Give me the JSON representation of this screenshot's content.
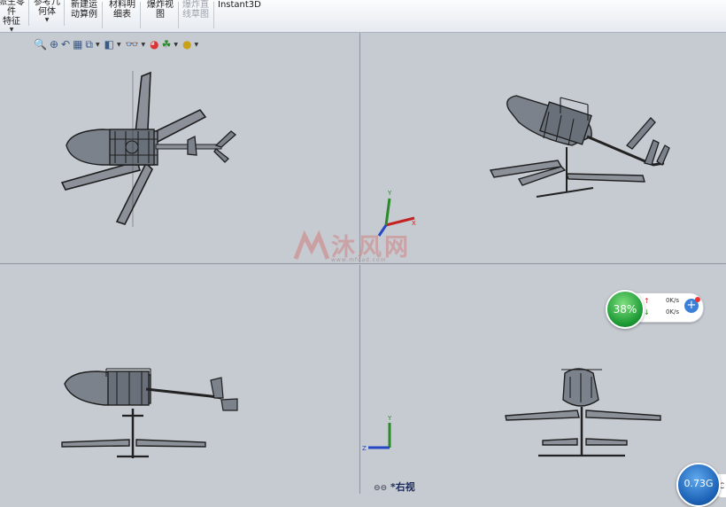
{
  "command_bar": {
    "items": [
      {
        "lines": [
          "派生零件",
          "特征"
        ],
        "dropdown": true
      },
      {
        "lines": [
          "参考几",
          "何体"
        ],
        "dropdown": true
      },
      {
        "lines": [
          "新建运",
          "动算例"
        ]
      },
      {
        "lines": [
          "材料明",
          "细表"
        ]
      },
      {
        "lines": [
          "爆炸视",
          "图"
        ]
      },
      {
        "lines": [
          "爆炸直",
          "线草图"
        ],
        "disabled": true
      },
      {
        "lines": [
          "Instant3D"
        ]
      }
    ]
  },
  "view_toolbar": {
    "icons": [
      "zoom-to-fit-icon",
      "zoom-area-icon",
      "previous-view-icon",
      "section-view-icon",
      "view-orientation-icon",
      "display-style-icon",
      "hide-show-items-icon",
      "edit-appearance-icon",
      "apply-scene-icon",
      "view-settings-icon"
    ]
  },
  "viewports": {
    "bottom_right_label": "*右视"
  },
  "watermark": {
    "text": "沐风网",
    "sub": "www.mfcad.com",
    "color": "#ce8484"
  },
  "network_widget": {
    "percent": "38%",
    "upload": "0K/s",
    "download": "0K/s",
    "upload_arrow": "↑",
    "download_arrow": "↓",
    "accent": "#2aa644"
  },
  "memory_widget": {
    "value": "0.73G",
    "tail": "C"
  },
  "colors": {
    "viewport_bg": "#c6cad1",
    "toolbar_bg": "#eef1f5",
    "label_color": "#1b2a5c"
  }
}
